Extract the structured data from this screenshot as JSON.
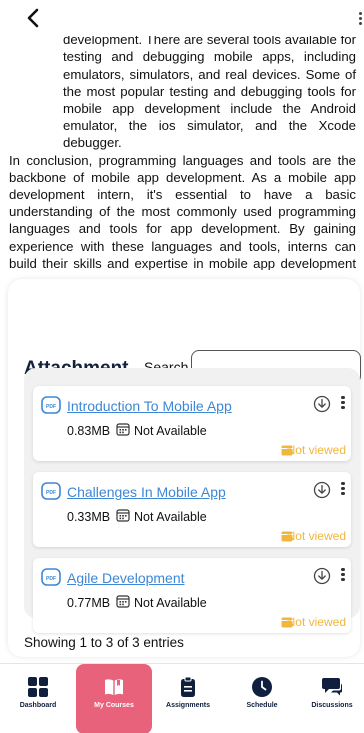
{
  "header": {
    "back_icon": "chevron-left-icon",
    "menu_icon": "more-vertical-icon"
  },
  "article": {
    "indented_text": "are critical components of mobile app development. There are several tools available for testing and debugging mobile apps, including emulators, simulators, and real devices. Some of the most popular testing and debugging tools for mobile app development include the Android emulator, the ios simulator, and the Xcode debugger.",
    "conclusion": "In conclusion, programming languages and tools are the backbone of mobile app development. As a mobile app development intern, it's essential to have a basic understanding of the most commonly used programming languages and tools for app development. By gaining experience with these languages and tools, interns can build their skills and expertise in mobile app development and prepare for a career in this exciting and rapidly growing field."
  },
  "attachment": {
    "title": "Attachment",
    "search_label": "Search",
    "search_value": "",
    "items": [
      {
        "name": "Introduction To Mobile App",
        "size": "0.83MB",
        "availability": "Not Available",
        "status": "Not viewed"
      },
      {
        "name": "Challenges In Mobile App",
        "size": "0.33MB",
        "availability": "Not Available",
        "status": "Not viewed"
      },
      {
        "name": "Agile Development",
        "size": "0.77MB",
        "availability": "Not Available",
        "status": "Not viewed"
      }
    ],
    "entries_text": "Showing 1 to 3 of 3 entries"
  },
  "nav": {
    "items": [
      {
        "label": "Dashboard",
        "icon": "dashboard-grid-icon"
      },
      {
        "label": "My Courses",
        "icon": "book-open-icon"
      },
      {
        "label": "Assignments",
        "icon": "clipboard-icon"
      },
      {
        "label": "Schedule",
        "icon": "clock-icon"
      },
      {
        "label": "Discussions",
        "icon": "chat-bubbles-icon"
      }
    ],
    "active": "My Courses"
  },
  "colors": {
    "link": "#3d87d6",
    "viewed": "#f0b73d",
    "nav_active": "#e8627b",
    "heading": "#14213d"
  }
}
